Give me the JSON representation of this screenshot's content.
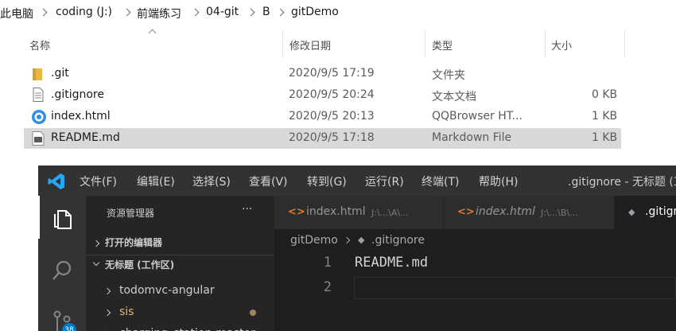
{
  "explorer": {
    "breadcrumb": [
      "此电脑",
      "coding (J:)",
      "前端练习",
      "04-git",
      "B",
      "gitDemo"
    ],
    "columns": {
      "name": "名称",
      "date": "修改日期",
      "type": "类型",
      "size": "大小"
    },
    "files": [
      {
        "name": ".git",
        "date": "2020/9/5 17:19",
        "type": "文件夹",
        "size": "",
        "icon": "folder-icon"
      },
      {
        "name": ".gitignore",
        "date": "2020/9/5 20:24",
        "type": "文本文档",
        "size": "0 KB",
        "icon": "text-file-icon"
      },
      {
        "name": "index.html",
        "date": "2020/9/5 20:13",
        "type": "QQBrowser HT...",
        "size": "1 KB",
        "icon": "qqbrowser-icon"
      },
      {
        "name": "README.md",
        "date": "2020/9/5 17:18",
        "type": "Markdown File",
        "size": "1 KB",
        "icon": "markdown-file-icon",
        "selected": true
      }
    ]
  },
  "vscode": {
    "menu": [
      "文件(F)",
      "编辑(E)",
      "选择(S)",
      "查看(V)",
      "转到(G)",
      "运行(R)",
      "终端(T)",
      "帮助(H)"
    ],
    "window_title": ".gitignore - 无标题 (工",
    "sidebar": {
      "title": "资源管理器",
      "more": "···",
      "open_editors": "打开的编辑器",
      "workspace": "无标题 (工作区)",
      "folders": [
        "todomvc-angular",
        "sis",
        "charging_station-master"
      ]
    },
    "tabs": [
      {
        "icon": "<>",
        "name": "index.html",
        "path": "J:\\...\\A\\..."
      },
      {
        "icon": "<>",
        "name": "index.html",
        "path": "J:\\...\\B\\..."
      },
      {
        "icon": "◆",
        "name": ".gitign"
      }
    ],
    "editor_breadcrumb": {
      "folder": "gitDemo",
      "file": ".gitignore"
    },
    "lines": [
      {
        "n": "1",
        "text": "README.md"
      },
      {
        "n": "2",
        "text": ""
      }
    ],
    "badge": "38",
    "colors": {
      "accent": "#007acc",
      "titlebar": "#323233",
      "activitybar": "#333333",
      "sidebar": "#252526",
      "editor": "#1e1e1e",
      "folder_git": "#dcb67a"
    }
  }
}
